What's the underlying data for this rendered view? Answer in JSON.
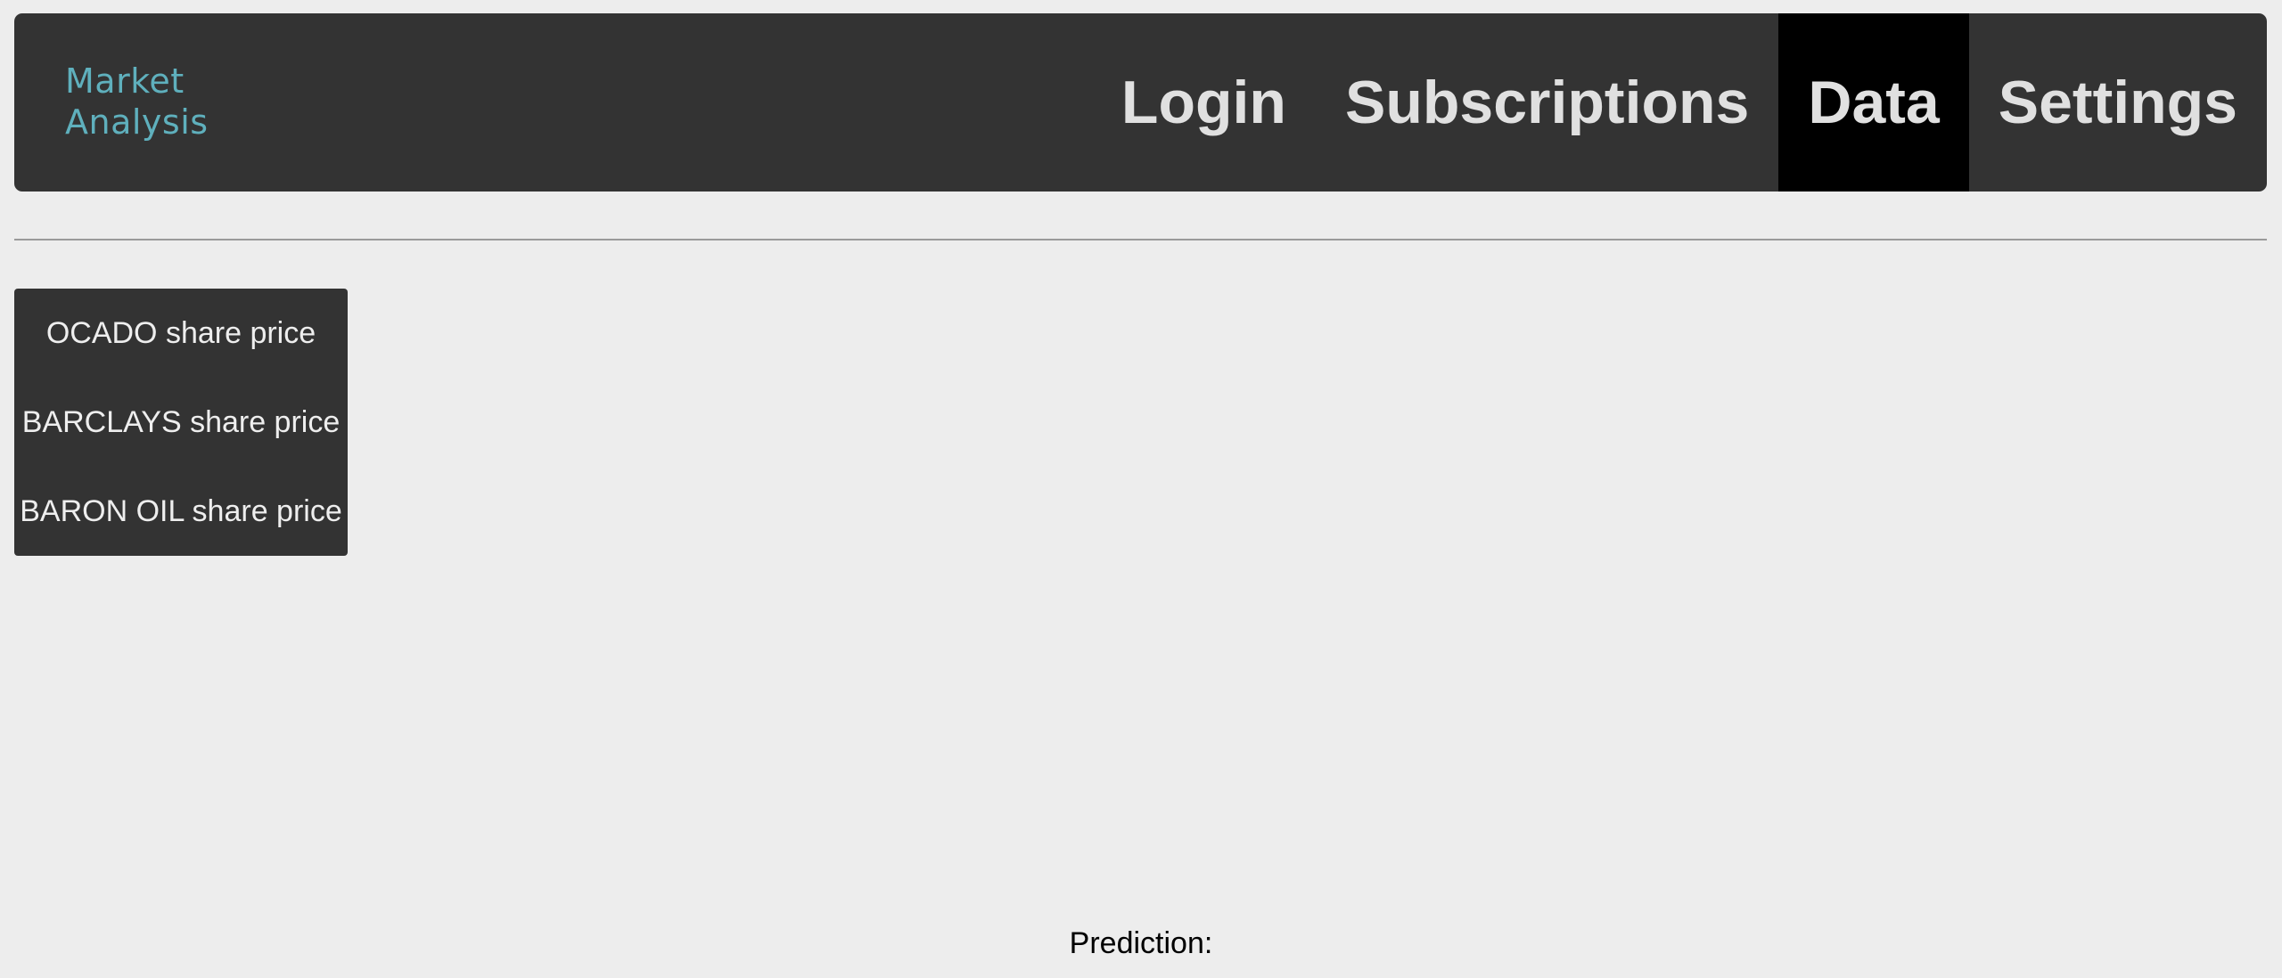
{
  "brand": {
    "line1": "Market",
    "line2": "Analysis",
    "color": "#5fb0bd"
  },
  "nav": {
    "items": [
      {
        "label": "Login",
        "active": false
      },
      {
        "label": "Subscriptions",
        "active": false
      },
      {
        "label": "Data",
        "active": true
      },
      {
        "label": "Settings",
        "active": false
      }
    ]
  },
  "stocks": {
    "items": [
      {
        "label": "OCADO share price"
      },
      {
        "label": "BARCLAYS share price"
      },
      {
        "label": "BARON OIL share price"
      }
    ]
  },
  "prediction": {
    "label": "Prediction:"
  },
  "colors": {
    "background": "#ededed",
    "navbar": "#333333",
    "active_tab": "#000000",
    "nav_text": "#e0e0e0"
  }
}
